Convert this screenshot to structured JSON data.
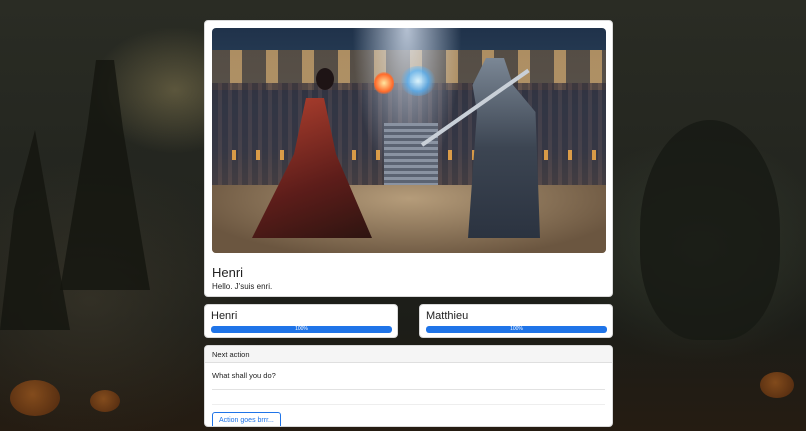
{
  "scene": {
    "speaker": "Henri",
    "dialogue": "Hello. J'suis enri."
  },
  "players": [
    {
      "name": "Henri",
      "health_percent": 100,
      "health_label": "100%"
    },
    {
      "name": "Matthieu",
      "health_percent": 100,
      "health_label": "100%"
    }
  ],
  "action": {
    "header": "Next action",
    "question": "What shall you do?",
    "button_label": "Action goes brrr..."
  },
  "colors": {
    "accent": "#1f74e8",
    "card_background": "#ffffff",
    "page_background": "#1f211b"
  }
}
